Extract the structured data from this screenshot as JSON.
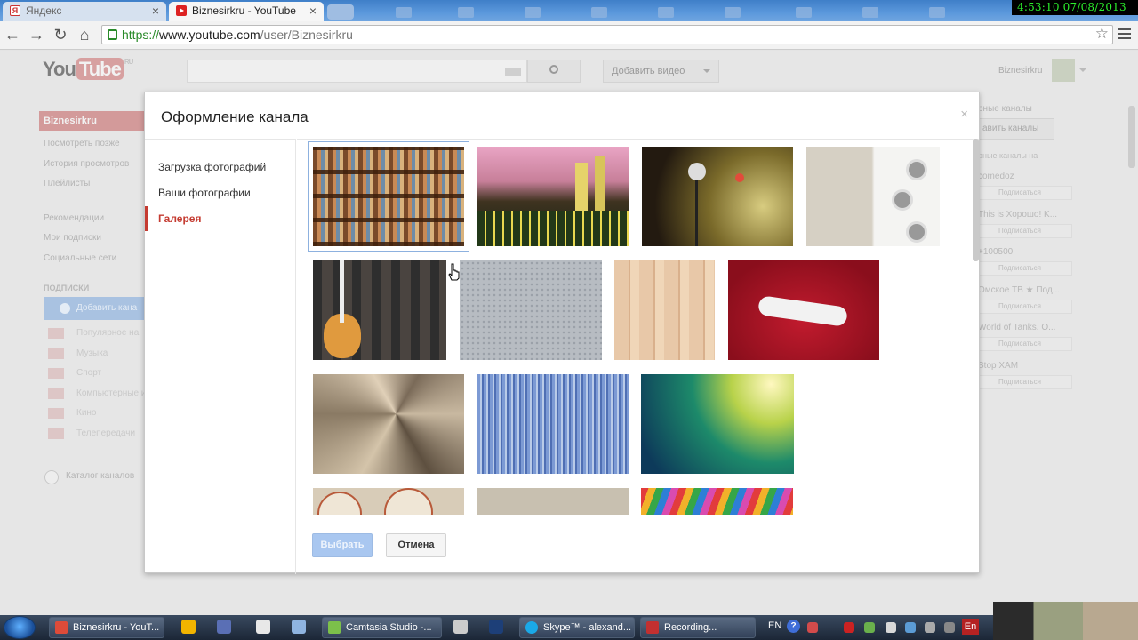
{
  "browser": {
    "tabs": [
      {
        "title": "Яндекс",
        "favicon_letter": "Я",
        "active": false
      },
      {
        "title": "Biznesirkru - YouTube",
        "active": true
      }
    ],
    "clock": "4:53:10  07/08/2013",
    "url_scheme": "https://",
    "url_host": "www.youtube.com",
    "url_path": "/user/Biznesirkru"
  },
  "youtube": {
    "logo_you": "You",
    "logo_tube": "Tube",
    "logo_region": "RU",
    "upload_label": "Добавить видео",
    "username": "Biznesirkru",
    "guide": {
      "active_item": "Biznesirkru",
      "items": [
        "Посмотреть позже",
        "История просмотров",
        "Плейлисты"
      ],
      "items2": [
        "Рекомендации",
        "Мои подписки",
        "Социальные сети"
      ],
      "subscriptions_header": "ПОДПИСКИ",
      "add_channels": "Добавить кана",
      "subscriptions": [
        "Популярное на",
        "Музыка",
        "Спорт",
        "Компьютерные и",
        "Кино",
        "Телепередачи"
      ],
      "catalog": "Каталог каналов"
    },
    "rail": {
      "title": "рные каналы",
      "button": "авить каналы",
      "subtitle": "рные каналы на",
      "subscribe_label": "Подписаться",
      "channels": [
        "comedoz",
        "This is Хорошо! K...",
        "+100500",
        "Омское ТВ ★ Под...",
        "World of Tanks. O...",
        "Stop XAM"
      ]
    }
  },
  "dialog": {
    "title": "Оформление канала",
    "close": "×",
    "nav": [
      {
        "label": "Загрузка фотографий",
        "active": false
      },
      {
        "label": "Ваши фотографии",
        "active": false
      },
      {
        "label": "Галерея",
        "active": true
      }
    ],
    "select_button": "Выбрать",
    "cancel_button": "Отмена"
  },
  "taskbar": {
    "buttons": [
      "Biznesirkru - YouT...",
      "Camtasia Studio -...",
      "Skype™ - alexand...",
      "Recording..."
    ],
    "lang": "EN",
    "lang_indicator": "En"
  },
  "colors": {
    "accent_red": "#c53b31",
    "select_blue": "#a9c7f0"
  }
}
